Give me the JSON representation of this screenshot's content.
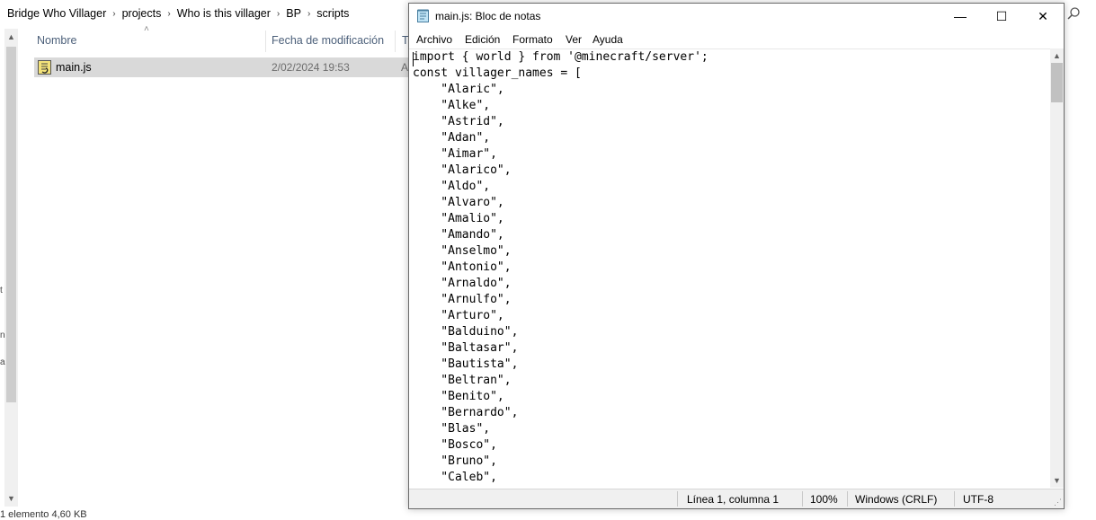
{
  "explorer": {
    "breadcrumb": [
      "Bridge Who Villager",
      "projects",
      "Who is this villager",
      "BP",
      "scripts"
    ],
    "columns": {
      "name": "Nombre",
      "modified": "Fecha de modificación",
      "type_partial": "Ti"
    },
    "file": {
      "name": "main.js",
      "modified": "2/02/2024 19:53",
      "type_partial": "A"
    },
    "status_partial": "1 elemento 4,60 KB"
  },
  "notepad": {
    "title": "main.js: Bloc de notas",
    "window_buttons": {
      "minimize": "—",
      "maximize": "☐",
      "close": "✕"
    },
    "menu": [
      "Archivo",
      "Edición",
      "Formato",
      "Ver",
      "Ayuda"
    ],
    "lines": [
      "import { world } from '@minecraft/server';",
      "const villager_names = [",
      "    \"Alaric\",",
      "    \"Alke\",",
      "    \"Astrid\",",
      "    \"Adan\",",
      "    \"Aimar\",",
      "    \"Alarico\",",
      "    \"Aldo\",",
      "    \"Alvaro\",",
      "    \"Amalio\",",
      "    \"Amando\",",
      "    \"Anselmo\",",
      "    \"Antonio\",",
      "    \"Arnaldo\",",
      "    \"Arnulfo\",",
      "    \"Arturo\",",
      "    \"Balduino\",",
      "    \"Baltasar\",",
      "    \"Bautista\",",
      "    \"Beltran\",",
      "    \"Benito\",",
      "    \"Bernardo\",",
      "    \"Blas\",",
      "    \"Bosco\",",
      "    \"Bruno\",",
      "    \"Caleb\","
    ],
    "status": {
      "position": "Línea 1, columna 1",
      "zoom": "100%",
      "line_endings": "Windows (CRLF)",
      "encoding": "UTF-8"
    }
  },
  "colors": {
    "selection": "#d9d9d9",
    "header_text": "#4c607a",
    "chrome": "#f0f0f0"
  }
}
